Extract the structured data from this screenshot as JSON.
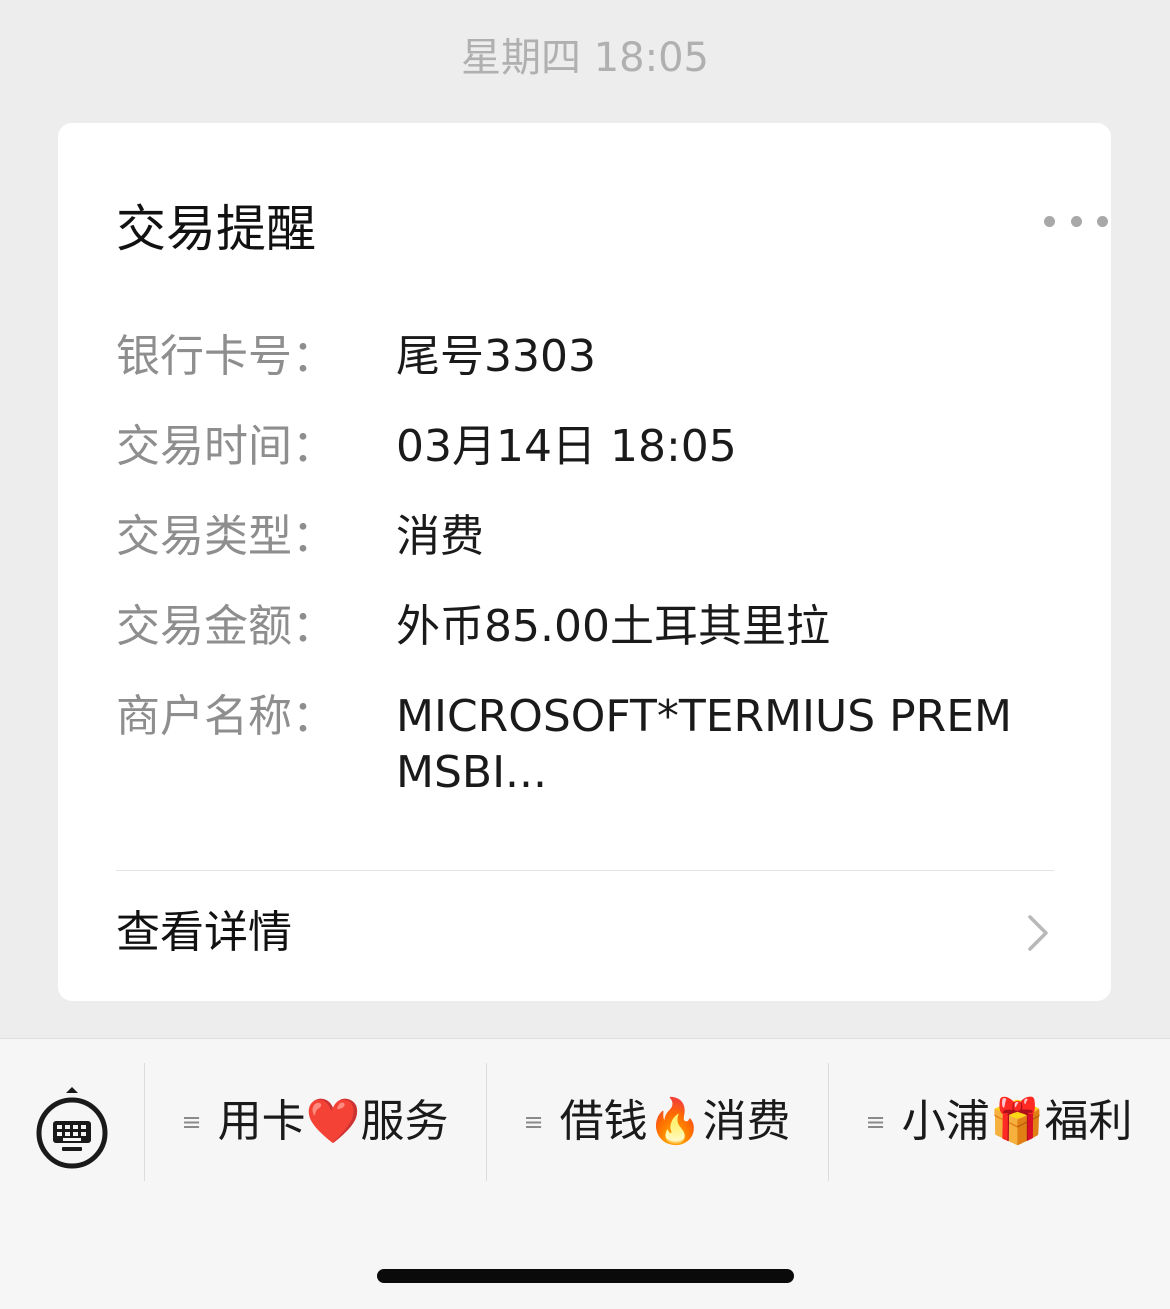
{
  "chat": {
    "timestamp": "星期四 18:05"
  },
  "card": {
    "title": "交易提醒",
    "more_icon": "more-horizontal-icon",
    "rows": [
      {
        "label": "银行卡号：",
        "value": "尾号3303"
      },
      {
        "label": "交易时间：",
        "value": "03月14日 18:05"
      },
      {
        "label": "交易类型：",
        "value": "消费"
      },
      {
        "label": "交易金额：",
        "value": "外币85.00土耳其里拉"
      },
      {
        "label": "商户名称：",
        "value": "MICROSOFT*TERMIUS PREM MSBI..."
      }
    ],
    "details_label": "查看详情",
    "details_icon": "chevron-right-icon"
  },
  "bottom_menu": {
    "keyboard_icon": "keyboard-icon",
    "menu_icon": "menu-lines-icon",
    "items": [
      {
        "label": "用卡❤️服务"
      },
      {
        "label": "借钱🔥消费"
      },
      {
        "label": "小浦🎁福利"
      }
    ]
  }
}
